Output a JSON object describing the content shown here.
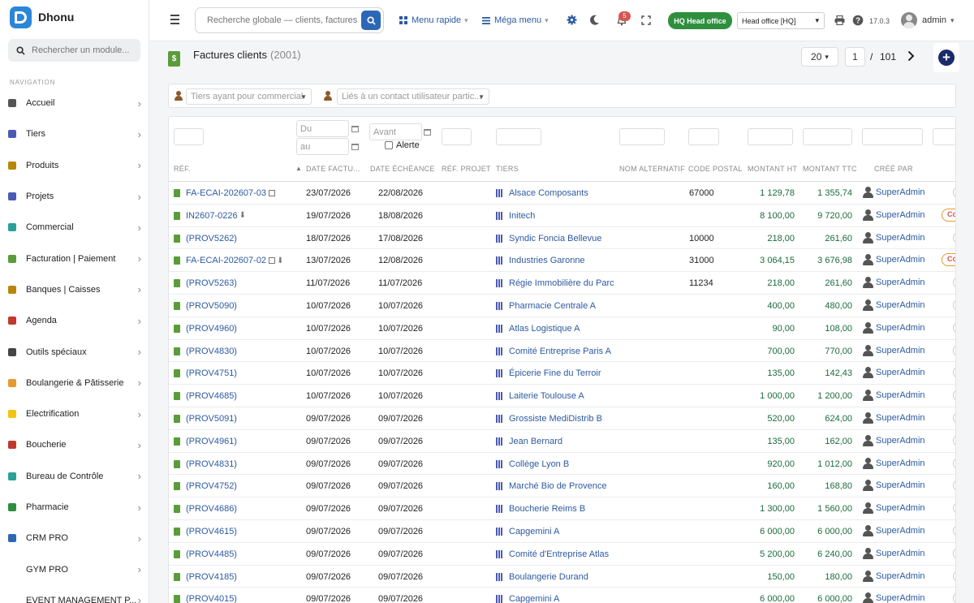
{
  "app": {
    "name": "Dhonu"
  },
  "sidebar": {
    "search_placeholder": "Rechercher un module...",
    "section_title": "NAVIGATION",
    "items": [
      {
        "label": "Accueil",
        "icon": "home-icon",
        "color": "#555555"
      },
      {
        "label": "Tiers",
        "icon": "building-icon",
        "color": "#4a5ab5"
      },
      {
        "label": "Produits",
        "icon": "box-icon",
        "color": "#b8860b"
      },
      {
        "label": "Projets",
        "icon": "sitemap-icon",
        "color": "#4a5ab5"
      },
      {
        "label": "Commercial",
        "icon": "briefcase-icon",
        "color": "#2aa198"
      },
      {
        "label": "Facturation | Paiement",
        "icon": "invoice-icon",
        "color": "#5a9c3a"
      },
      {
        "label": "Banques | Caisses",
        "icon": "bank-icon",
        "color": "#b8860b"
      },
      {
        "label": "Agenda",
        "icon": "calendar-icon",
        "color": "#c0392b"
      },
      {
        "label": "Outils spéciaux",
        "icon": "tools-icon",
        "color": "#444444"
      },
      {
        "label": "Boulangerie & Pâtisserie",
        "icon": "bread-icon",
        "color": "#e6992e"
      },
      {
        "label": "Electrification",
        "icon": "bolt-icon",
        "color": "#f1c40f"
      },
      {
        "label": "Boucherie",
        "icon": "meat-icon",
        "color": "#c0392b"
      },
      {
        "label": "Bureau de Contrôle",
        "icon": "control-icon",
        "color": "#2aa198"
      },
      {
        "label": "Pharmacie",
        "icon": "plus-cross-icon",
        "color": "#2f8f3e"
      },
      {
        "label": "CRM PRO",
        "icon": "funnel-icon",
        "color": "#2c67b7"
      },
      {
        "label": "GYM PRO",
        "icon": "",
        "color": "#ffffff"
      },
      {
        "label": "EVENT MANAGEMENT P...",
        "icon": "",
        "color": "#ffffff"
      }
    ]
  },
  "topbar": {
    "search_placeholder": "Recherche globale — clients, factures, p",
    "menu_rapide": "Menu rapide",
    "mega_menu": "Méga menu",
    "notif_count": "5",
    "hq_badge": "HQ Head office",
    "hq_select": "Head office [HQ]",
    "version": "17.0.3",
    "user": "admin"
  },
  "page": {
    "title": "Factures clients",
    "count": "(2001)",
    "per_page": "20",
    "current_page": "1",
    "page_sep": "/",
    "total_pages": "101",
    "filter_commercial": "Tiers ayant pour commercial",
    "filter_contact": "Liés à un contact utilisateur partic..."
  },
  "filters": {
    "du": "Du",
    "au": "au",
    "avant": "Avant",
    "alerte": "Alerte"
  },
  "columns": [
    "RÉF.",
    "DATE FACTU...",
    "DATE ÉCHÉANCE",
    "RÉF. PROJET",
    "TIERS",
    "NOM ALTERNATIF",
    "CODE POSTAL",
    "MONTANT HT",
    "MONTANT TTC",
    "CRÉÉ PAR"
  ],
  "rows": [
    {
      "ref": "FA-ECAI-202607-03",
      "date": "23/07/2026",
      "due": "22/08/2026",
      "tiers": "Alsace Composants",
      "cp": "67000",
      "ht": "1 129,78",
      "ttc": "1 355,74",
      "by": "SuperAdmin",
      "extra": "doc",
      "status": "empty"
    },
    {
      "ref": "IN2607-0226",
      "date": "19/07/2026",
      "due": "18/08/2026",
      "tiers": "Initech",
      "cp": "",
      "ht": "8 100,00",
      "ttc": "9 720,00",
      "by": "SuperAdmin",
      "extra": "dl",
      "status": "Co"
    },
    {
      "ref": "(PROV5262)",
      "date": "18/07/2026",
      "due": "17/08/2026",
      "tiers": "Syndic Foncia Bellevue",
      "cp": "10000",
      "ht": "218,00",
      "ttc": "261,60",
      "by": "SuperAdmin",
      "extra": "",
      "status": "empty"
    },
    {
      "ref": "FA-ECAI-202607-02",
      "date": "13/07/2026",
      "due": "12/08/2026",
      "tiers": "Industries Garonne",
      "cp": "31000",
      "ht": "3 064,15",
      "ttc": "3 676,98",
      "by": "SuperAdmin",
      "extra": "docdl",
      "status": "Co"
    },
    {
      "ref": "(PROV5263)",
      "date": "11/07/2026",
      "due": "11/07/2026",
      "tiers": "Régie Immobilière du Parc",
      "cp": "11234",
      "ht": "218,00",
      "ttc": "261,60",
      "by": "SuperAdmin",
      "extra": "",
      "status": "empty"
    },
    {
      "ref": "(PROV5090)",
      "date": "10/07/2026",
      "due": "10/07/2026",
      "tiers": "Pharmacie Centrale A",
      "cp": "",
      "ht": "400,00",
      "ttc": "480,00",
      "by": "SuperAdmin",
      "extra": "",
      "status": "empty"
    },
    {
      "ref": "(PROV4960)",
      "date": "10/07/2026",
      "due": "10/07/2026",
      "tiers": "Atlas Logistique A",
      "cp": "",
      "ht": "90,00",
      "ttc": "108,00",
      "by": "SuperAdmin",
      "extra": "",
      "status": "empty"
    },
    {
      "ref": "(PROV4830)",
      "date": "10/07/2026",
      "due": "10/07/2026",
      "tiers": "Comité Entreprise Paris A",
      "cp": "",
      "ht": "700,00",
      "ttc": "770,00",
      "by": "SuperAdmin",
      "extra": "",
      "status": "empty"
    },
    {
      "ref": "(PROV4751)",
      "date": "10/07/2026",
      "due": "10/07/2026",
      "tiers": "Épicerie Fine du Terroir",
      "cp": "",
      "ht": "135,00",
      "ttc": "142,43",
      "by": "SuperAdmin",
      "extra": "",
      "status": "empty"
    },
    {
      "ref": "(PROV4685)",
      "date": "10/07/2026",
      "due": "10/07/2026",
      "tiers": "Laiterie Toulouse A",
      "cp": "",
      "ht": "1 000,00",
      "ttc": "1 200,00",
      "by": "SuperAdmin",
      "extra": "",
      "status": "empty"
    },
    {
      "ref": "(PROV5091)",
      "date": "09/07/2026",
      "due": "09/07/2026",
      "tiers": "Grossiste MediDistrib B",
      "cp": "",
      "ht": "520,00",
      "ttc": "624,00",
      "by": "SuperAdmin",
      "extra": "",
      "status": "empty"
    },
    {
      "ref": "(PROV4961)",
      "date": "09/07/2026",
      "due": "09/07/2026",
      "tiers": "Jean Bernard",
      "cp": "",
      "ht": "135,00",
      "ttc": "162,00",
      "by": "SuperAdmin",
      "extra": "",
      "status": "empty"
    },
    {
      "ref": "(PROV4831)",
      "date": "09/07/2026",
      "due": "09/07/2026",
      "tiers": "Collège Lyon B",
      "cp": "",
      "ht": "920,00",
      "ttc": "1 012,00",
      "by": "SuperAdmin",
      "extra": "",
      "status": "empty"
    },
    {
      "ref": "(PROV4752)",
      "date": "09/07/2026",
      "due": "09/07/2026",
      "tiers": "Marché Bio de Provence",
      "cp": "",
      "ht": "160,00",
      "ttc": "168,80",
      "by": "SuperAdmin",
      "extra": "",
      "status": "empty"
    },
    {
      "ref": "(PROV4686)",
      "date": "09/07/2026",
      "due": "09/07/2026",
      "tiers": "Boucherie Reims B",
      "cp": "",
      "ht": "1 300,00",
      "ttc": "1 560,00",
      "by": "SuperAdmin",
      "extra": "",
      "status": "empty"
    },
    {
      "ref": "(PROV4615)",
      "date": "09/07/2026",
      "due": "09/07/2026",
      "tiers": "Capgemini A",
      "cp": "",
      "ht": "6 000,00",
      "ttc": "6 000,00",
      "by": "SuperAdmin",
      "extra": "",
      "status": "empty"
    },
    {
      "ref": "(PROV4485)",
      "date": "09/07/2026",
      "due": "09/07/2026",
      "tiers": "Comité d'Entreprise Atlas",
      "cp": "",
      "ht": "5 200,00",
      "ttc": "6 240,00",
      "by": "SuperAdmin",
      "extra": "",
      "status": "empty"
    },
    {
      "ref": "(PROV4185)",
      "date": "09/07/2026",
      "due": "09/07/2026",
      "tiers": "Boulangerie Durand",
      "cp": "",
      "ht": "150,00",
      "ttc": "180,00",
      "by": "SuperAdmin",
      "extra": "",
      "status": "empty"
    },
    {
      "ref": "(PROV4015)",
      "date": "09/07/2026",
      "due": "09/07/2026",
      "tiers": "Capgemini A",
      "cp": "",
      "ht": "6 000,00",
      "ttc": "6 000,00",
      "by": "SuperAdmin",
      "extra": "",
      "status": "empty"
    }
  ]
}
